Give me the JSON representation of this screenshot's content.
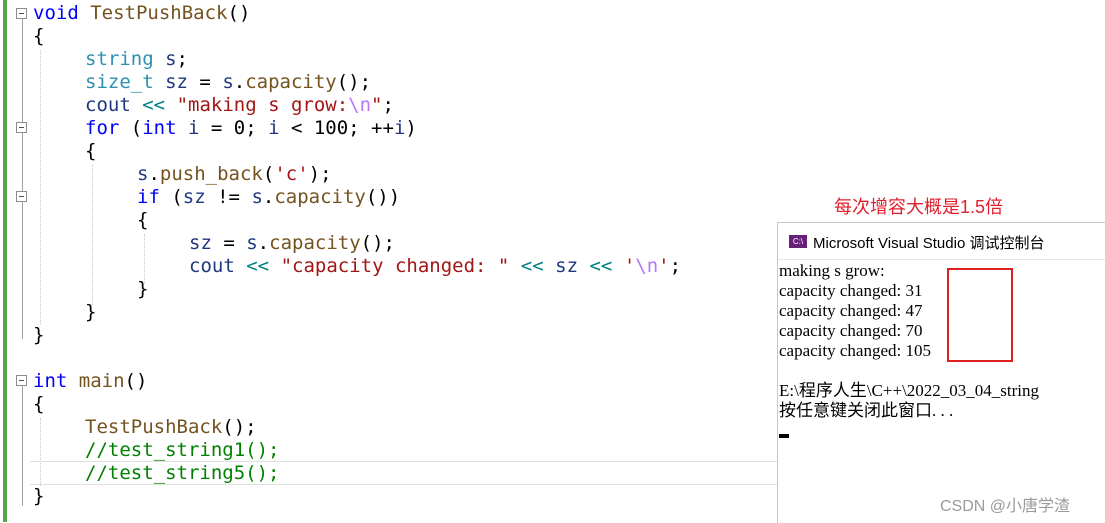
{
  "editor": {
    "line1": {
      "kw": "void",
      "fn": "TestPushBack",
      "rest": "()"
    },
    "line2": "{",
    "line3": {
      "ty": "string",
      "id": "s",
      "rest": ";"
    },
    "line4": {
      "ty": "size_t",
      "id": "sz",
      "eq": " = ",
      "obj": "s",
      "dot": ".",
      "fn": "capacity",
      "rest": "();"
    },
    "line5": {
      "id": "cout",
      "op": "<<",
      "str_a": "\"making s grow:",
      "esc": "\\n",
      "str_b": "\"",
      "rest": ";"
    },
    "line6": {
      "kw": "for",
      "p1": " (",
      "kw2": "int",
      "i1": "i",
      "p2": " = 0; ",
      "i2": "i",
      "p3": " < 100; ++",
      "i3": "i",
      "p4": ")"
    },
    "line7": "{",
    "line8": {
      "obj": "s",
      "dot": ".",
      "fn": "push_back",
      "p1": "(",
      "str": "'c'",
      "p2": ");"
    },
    "line9": {
      "kw": "if",
      "p1": " (",
      "id": "sz",
      "p2": " != ",
      "obj": "s",
      "dot": ".",
      "fn": "capacity",
      "p3": "())"
    },
    "line10": "{",
    "line11": {
      "id": "sz",
      "eq": " = ",
      "obj": "s",
      "dot": ".",
      "fn": "capacity",
      "rest": "();"
    },
    "line12": {
      "id": "cout",
      "op1": "<<",
      "str": "\"capacity changed: \"",
      "op2": "<<",
      "id2": "sz",
      "op3": "<<",
      "str2a": "'",
      "esc": "\\n",
      "str2b": "'",
      "rest": ";"
    },
    "line13": "}",
    "line14": "}",
    "line15": "}",
    "line16": {
      "kw": "int",
      "fn": "main",
      "rest": "()"
    },
    "line17": "{",
    "line18": {
      "fn": "TestPushBack",
      "rest": "();"
    },
    "line19": "//test_string1();",
    "line20": "//test_string5();",
    "line21": "}"
  },
  "annotation": "每次增容大概是1.5倍",
  "console": {
    "icon": "C:\\",
    "title": "Microsoft Visual Studio 调试控制台",
    "lines": [
      "making s grow:",
      "capacity changed: 31",
      "capacity changed: 47",
      "capacity changed: 70",
      "capacity changed: 105",
      "",
      "E:\\程序人生\\C++\\2022_03_04_string",
      "按任意键关闭此窗口. . ."
    ]
  },
  "watermark": "CSDN @小唐学渣",
  "colors": {
    "keyword": "#0000ff",
    "type": "#2b91af",
    "string": "#a31515",
    "comment": "#008000",
    "highlight": "#e02020"
  }
}
